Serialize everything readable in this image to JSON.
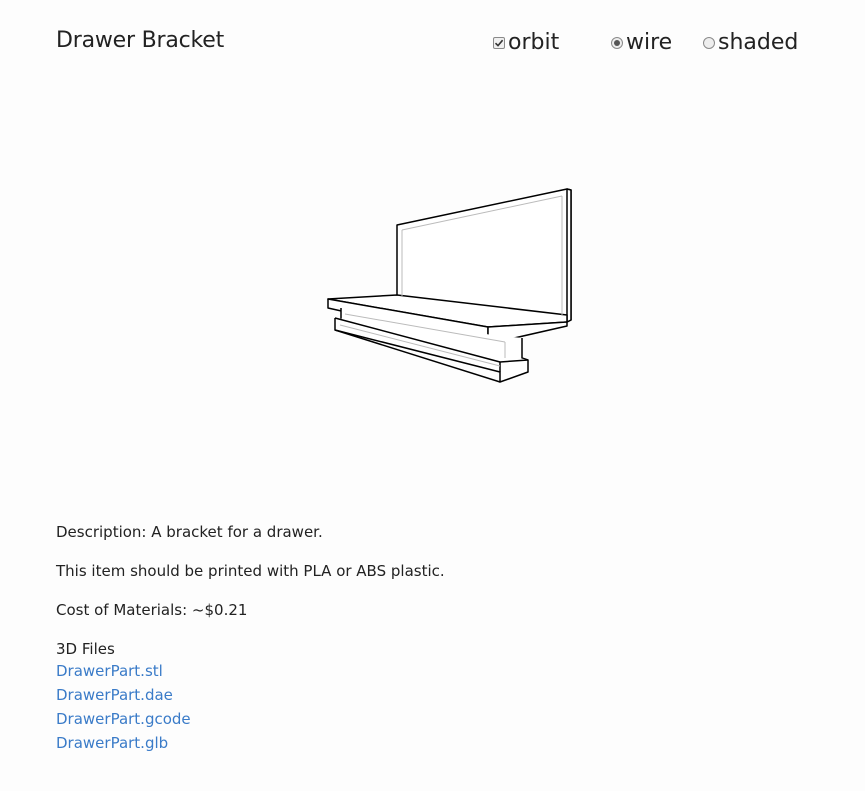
{
  "header": {
    "title": "Drawer Bracket"
  },
  "controls": {
    "orbit": {
      "label": "orbit",
      "checked": true
    },
    "view_mode": {
      "options": [
        {
          "label": "wire",
          "selected": true
        },
        {
          "label": "shaded",
          "selected": false
        }
      ]
    }
  },
  "details": {
    "description": "Description: A bracket for a drawer.",
    "material": "This item should be printed with PLA or ABS plastic.",
    "cost": "Cost of Materials: ~$0.21",
    "files_heading": "3D Files",
    "files": [
      {
        "label": "DrawerPart.stl"
      },
      {
        "label": "DrawerPart.dae"
      },
      {
        "label": "DrawerPart.gcode"
      },
      {
        "label": "DrawerPart.glb"
      }
    ]
  },
  "colors": {
    "link": "#3a7bc8",
    "text": "#222222",
    "background": "#fdfdfd"
  }
}
